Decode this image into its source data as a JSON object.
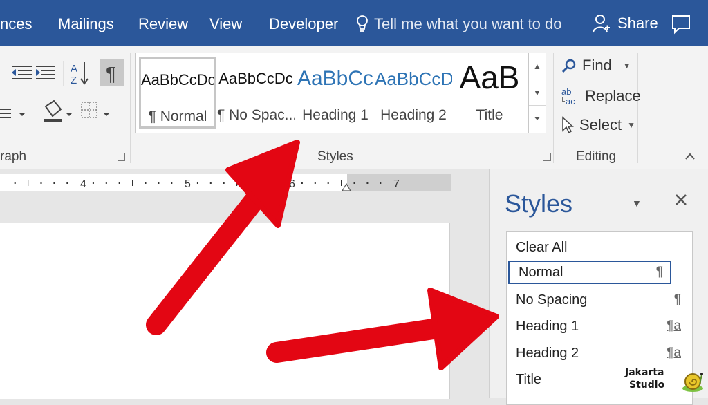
{
  "ribbon_tabs": {
    "references_partial": "nces",
    "mailings": "Mailings",
    "review": "Review",
    "view": "View",
    "developer": "Developer"
  },
  "tell_me": {
    "placeholder": "Tell me what you want to do"
  },
  "share": {
    "label": "Share"
  },
  "groups": {
    "paragraph_partial": "raph",
    "styles": "Styles",
    "editing": "Editing"
  },
  "style_gallery": [
    {
      "preview": "AaBbCcDc",
      "caption": "¶ Normal"
    },
    {
      "preview": "AaBbCcDc",
      "caption": "¶ No Spac..."
    },
    {
      "preview": "AaBbCc",
      "caption": "Heading 1"
    },
    {
      "preview": "AaBbCcD",
      "caption": "Heading 2"
    },
    {
      "preview": "AaB",
      "caption": "Title"
    }
  ],
  "editing": {
    "find": "Find",
    "replace": "Replace",
    "select": "Select"
  },
  "ruler": {
    "marks": [
      "4",
      "5",
      "6",
      "7"
    ]
  },
  "styles_pane": {
    "title": "Styles",
    "items": [
      {
        "name": "Clear All",
        "mark": ""
      },
      {
        "name": "Normal",
        "mark": "¶"
      },
      {
        "name": "No Spacing",
        "mark": "¶"
      },
      {
        "name": "Heading 1",
        "mark": "¶a"
      },
      {
        "name": "Heading 2",
        "mark": "¶a"
      },
      {
        "name": "Title",
        "mark": ""
      }
    ]
  },
  "watermark": {
    "line1": "Jakarta",
    "line2": "Studio"
  },
  "colors": {
    "accent": "#2b579a",
    "arrow": "#e30613"
  }
}
